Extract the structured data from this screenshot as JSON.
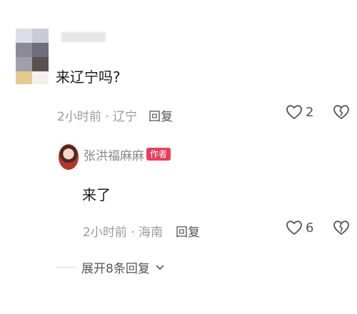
{
  "comment": {
    "text": "来辽宁吗?",
    "time": "2小时前",
    "location": "辽宁",
    "reply_label": "回复",
    "likes": "2"
  },
  "reply": {
    "author": "张洪福麻麻",
    "badge": "作者",
    "text": "来了",
    "time": "2小时前",
    "location": "海南",
    "reply_label": "回复",
    "likes": "6"
  },
  "expand": {
    "label": "展开8条回复"
  },
  "icons": {
    "like": "heart-outline-icon",
    "dislike": "broken-heart-icon",
    "expand": "chevron-down-icon"
  },
  "colors": {
    "badge": "#ea3d5a",
    "meta_text": "#9a9a9a",
    "icon_stroke": "#555555"
  }
}
